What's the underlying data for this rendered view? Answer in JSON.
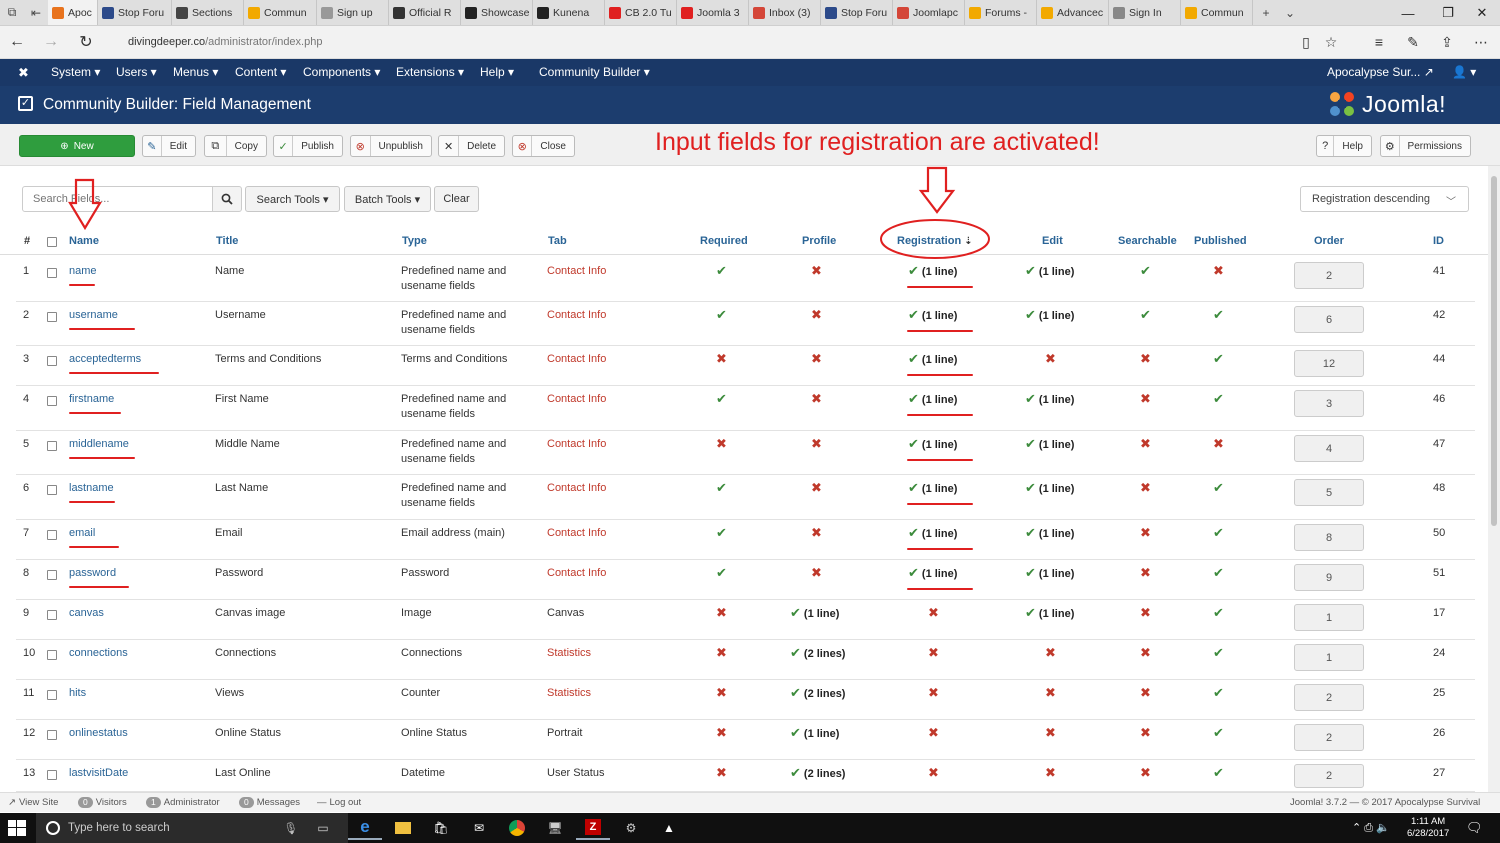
{
  "browser": {
    "tabs": [
      {
        "label": "Apoc",
        "color": "#e8731d",
        "active": true
      },
      {
        "label": "Stop Foru",
        "color": "#2c4a8a"
      },
      {
        "label": "Sections",
        "color": "#444444"
      },
      {
        "label": "Commun",
        "color": "#f2a900"
      },
      {
        "label": "Sign up",
        "color": "#999999"
      },
      {
        "label": "Official R",
        "color": "#333333"
      },
      {
        "label": "Showcase",
        "color": "#222222"
      },
      {
        "label": "Kunena",
        "color": "#222222"
      },
      {
        "label": "CB 2.0 Tu",
        "color": "#e02020"
      },
      {
        "label": "Joomla 3",
        "color": "#e02020"
      },
      {
        "label": "Inbox (3)",
        "color": "#d44638"
      },
      {
        "label": "Stop Foru",
        "color": "#2c4a8a"
      },
      {
        "label": "Joomlapc",
        "color": "#d44638"
      },
      {
        "label": "Forums -",
        "color": "#f2a900"
      },
      {
        "label": "Advancec",
        "color": "#f2a900"
      },
      {
        "label": "Sign In",
        "color": "#888888"
      },
      {
        "label": "Commun",
        "color": "#f2a900"
      }
    ],
    "url_host": "divingdeeper.co",
    "url_path": "/administrator/index.php"
  },
  "admin_menu": {
    "items": [
      "System ▾",
      "Users ▾",
      "Menus ▾",
      "Content ▾",
      "Components ▾",
      "Extensions ▾",
      "Help ▾",
      "Community Builder ▾"
    ],
    "user_label": "Apocalypse Sur..."
  },
  "header": {
    "title": "Community Builder: Field Management",
    "logo_text": "Joomla!"
  },
  "toolbar": {
    "new_label": "New",
    "edit_label": "Edit",
    "copy_label": "Copy",
    "publish_label": "Publish",
    "unpublish_label": "Unpublish",
    "delete_label": "Delete",
    "close_label": "Close",
    "help_label": "Help",
    "permissions_label": "Permissions"
  },
  "annotation": {
    "text": "Input fields for registration are activated!"
  },
  "filters": {
    "search_placeholder": "Search Fields...",
    "search_tools_label": "Search Tools ▾",
    "batch_tools_label": "Batch Tools ▾",
    "clear_label": "Clear",
    "sort_label": "Registration descending"
  },
  "table": {
    "headers": {
      "num": "#",
      "name": "Name",
      "title": "Title",
      "type": "Type",
      "tab": "Tab",
      "required": "Required",
      "profile": "Profile",
      "registration": "Registration",
      "edit": "Edit",
      "searchable": "Searchable",
      "published": "Published",
      "order": "Order",
      "id": "ID"
    },
    "rows": [
      {
        "num": "1",
        "name": "name",
        "title": "Name",
        "type1": "Predefined name and",
        "type2": "usename fields",
        "tab": "Contact Info",
        "tab_link": true,
        "required": true,
        "profile": false,
        "profile_text": "",
        "registration": true,
        "registration_text": "(1 line)",
        "edit": true,
        "edit_text": "(1 line)",
        "searchable": true,
        "published": false,
        "order": "2",
        "id": "41"
      },
      {
        "num": "2",
        "name": "username",
        "title": "Username",
        "type1": "Predefined name and",
        "type2": "usename fields",
        "tab": "Contact Info",
        "tab_link": true,
        "required": true,
        "profile": false,
        "profile_text": "",
        "registration": true,
        "registration_text": "(1 line)",
        "edit": true,
        "edit_text": "(1 line)",
        "searchable": true,
        "published": true,
        "order": "6",
        "id": "42"
      },
      {
        "num": "3",
        "name": "acceptedterms",
        "title": "Terms and Conditions",
        "type1": "Terms and Conditions",
        "type2": "",
        "tab": "Contact Info",
        "tab_link": true,
        "required": false,
        "profile": false,
        "profile_text": "",
        "registration": true,
        "registration_text": "(1 line)",
        "edit": false,
        "edit_text": "",
        "searchable": false,
        "published": true,
        "order": "12",
        "id": "44"
      },
      {
        "num": "4",
        "name": "firstname",
        "title": "First Name",
        "type1": "Predefined name and",
        "type2": "usename fields",
        "tab": "Contact Info",
        "tab_link": true,
        "required": true,
        "profile": false,
        "profile_text": "",
        "registration": true,
        "registration_text": "(1 line)",
        "edit": true,
        "edit_text": "(1 line)",
        "searchable": false,
        "published": true,
        "order": "3",
        "id": "46"
      },
      {
        "num": "5",
        "name": "middlename",
        "title": "Middle Name",
        "type1": "Predefined name and",
        "type2": "usename fields",
        "tab": "Contact Info",
        "tab_link": true,
        "required": false,
        "profile": false,
        "profile_text": "",
        "registration": true,
        "registration_text": "(1 line)",
        "edit": true,
        "edit_text": "(1 line)",
        "searchable": false,
        "published": false,
        "order": "4",
        "id": "47"
      },
      {
        "num": "6",
        "name": "lastname",
        "title": "Last Name",
        "type1": "Predefined name and",
        "type2": "usename fields",
        "tab": "Contact Info",
        "tab_link": true,
        "required": true,
        "profile": false,
        "profile_text": "",
        "registration": true,
        "registration_text": "(1 line)",
        "edit": true,
        "edit_text": "(1 line)",
        "searchable": false,
        "published": true,
        "order": "5",
        "id": "48"
      },
      {
        "num": "7",
        "name": "email",
        "title": "Email",
        "type1": "Email address (main)",
        "type2": "",
        "tab": "Contact Info",
        "tab_link": true,
        "required": true,
        "profile": false,
        "profile_text": "",
        "registration": true,
        "registration_text": "(1 line)",
        "edit": true,
        "edit_text": "(1 line)",
        "searchable": false,
        "published": true,
        "order": "8",
        "id": "50"
      },
      {
        "num": "8",
        "name": "password",
        "title": "Password",
        "type1": "Password",
        "type2": "",
        "tab": "Contact Info",
        "tab_link": true,
        "required": true,
        "profile": false,
        "profile_text": "",
        "registration": true,
        "registration_text": "(1 line)",
        "edit": true,
        "edit_text": "(1 line)",
        "searchable": false,
        "published": true,
        "order": "9",
        "id": "51"
      },
      {
        "num": "9",
        "name": "canvas",
        "title": "Canvas image",
        "type1": "Image",
        "type2": "",
        "tab": "Canvas",
        "tab_link": false,
        "required": false,
        "profile": true,
        "profile_text": "(1 line)",
        "registration": false,
        "registration_text": "",
        "edit": true,
        "edit_text": "(1 line)",
        "searchable": false,
        "published": true,
        "order": "1",
        "id": "17"
      },
      {
        "num": "10",
        "name": "connections",
        "title": "Connections",
        "type1": "Connections",
        "type2": "",
        "tab": "Statistics",
        "tab_link": true,
        "required": false,
        "profile": true,
        "profile_text": "(2 lines)",
        "registration": false,
        "registration_text": "",
        "edit": false,
        "edit_text": "",
        "searchable": false,
        "published": true,
        "order": "1",
        "id": "24"
      },
      {
        "num": "11",
        "name": "hits",
        "title": "Views",
        "type1": "Counter",
        "type2": "",
        "tab": "Statistics",
        "tab_link": true,
        "required": false,
        "profile": true,
        "profile_text": "(2 lines)",
        "registration": false,
        "registration_text": "",
        "edit": false,
        "edit_text": "",
        "searchable": false,
        "published": true,
        "order": "2",
        "id": "25"
      },
      {
        "num": "12",
        "name": "onlinestatus",
        "title": "Online Status",
        "type1": "Online Status",
        "type2": "",
        "tab": "Portrait",
        "tab_link": false,
        "required": false,
        "profile": true,
        "profile_text": "(1 line)",
        "registration": false,
        "registration_text": "",
        "edit": false,
        "edit_text": "",
        "searchable": false,
        "published": true,
        "order": "2",
        "id": "26"
      },
      {
        "num": "13",
        "name": "lastvisitDate",
        "title": "Last Online",
        "type1": "Datetime",
        "type2": "",
        "tab": "User Status",
        "tab_link": false,
        "required": false,
        "profile": true,
        "profile_text": "(2 lines)",
        "registration": false,
        "registration_text": "",
        "edit": false,
        "edit_text": "",
        "searchable": false,
        "published": true,
        "order": "2",
        "id": "27"
      }
    ]
  },
  "status_bar": {
    "view_site": "View Site",
    "visitors_count": "0",
    "visitors": "Visitors",
    "admin_count": "1",
    "administrator": "Administrator",
    "messages_count": "0",
    "messages": "Messages",
    "logout": "Log out",
    "version": "Joomla! 3.7.2 — © 2017 Apocalypse Survival"
  },
  "taskbar": {
    "search_placeholder": "Type here to search",
    "time": "1:11 AM",
    "date": "6/28/2017"
  },
  "colors": {
    "nav": "#1a3867",
    "header": "#1c3d6e",
    "new_button": "#2f9d3e",
    "check": "#3c8b3c",
    "cross": "#c0392b",
    "annotation": "#e02020"
  }
}
